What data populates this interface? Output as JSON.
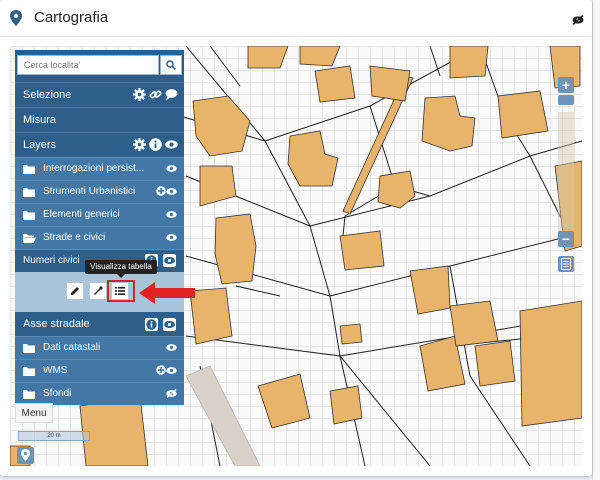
{
  "window": {
    "title": "Cartografia"
  },
  "search": {
    "placeholder": "Cerca localita'"
  },
  "sections": {
    "selezione": "Selezione",
    "misura": "Misura",
    "layers": "Layers",
    "asse_stradale": "Asse stradale"
  },
  "layer_groups": [
    {
      "label": "Interrogazioni persist..."
    },
    {
      "label": "Strumenti Urbanistici"
    },
    {
      "label": "Elementi generici"
    },
    {
      "label": "Strade e civici"
    }
  ],
  "numeri_civici": {
    "label": "Numeri civici",
    "tooltip": "Visualizza tabella"
  },
  "bottom_groups": [
    {
      "label": "Dati catastali"
    },
    {
      "label": "WMS"
    },
    {
      "label": "Sfondi"
    }
  ],
  "menu": {
    "label": "Menu"
  },
  "scale": {
    "label": "20 m"
  },
  "colors": {
    "panel": "#2e5f8a",
    "panel_row": "#4277a6",
    "building": "#e8b46b",
    "highlight": "#e0211f",
    "tool_bar": "#a9c3d8"
  },
  "icons": [
    "pin-icon",
    "eye-slash-icon",
    "search-icon",
    "gear-icon",
    "link-icon",
    "comment-icon",
    "info-icon",
    "eye-icon",
    "folder-icon",
    "plus-circle-icon",
    "pencil-icon",
    "dropper-icon",
    "list-icon",
    "zoom-in-icon",
    "zoom-out-icon",
    "legend-icon",
    "arrow-icon",
    "location-icon"
  ]
}
